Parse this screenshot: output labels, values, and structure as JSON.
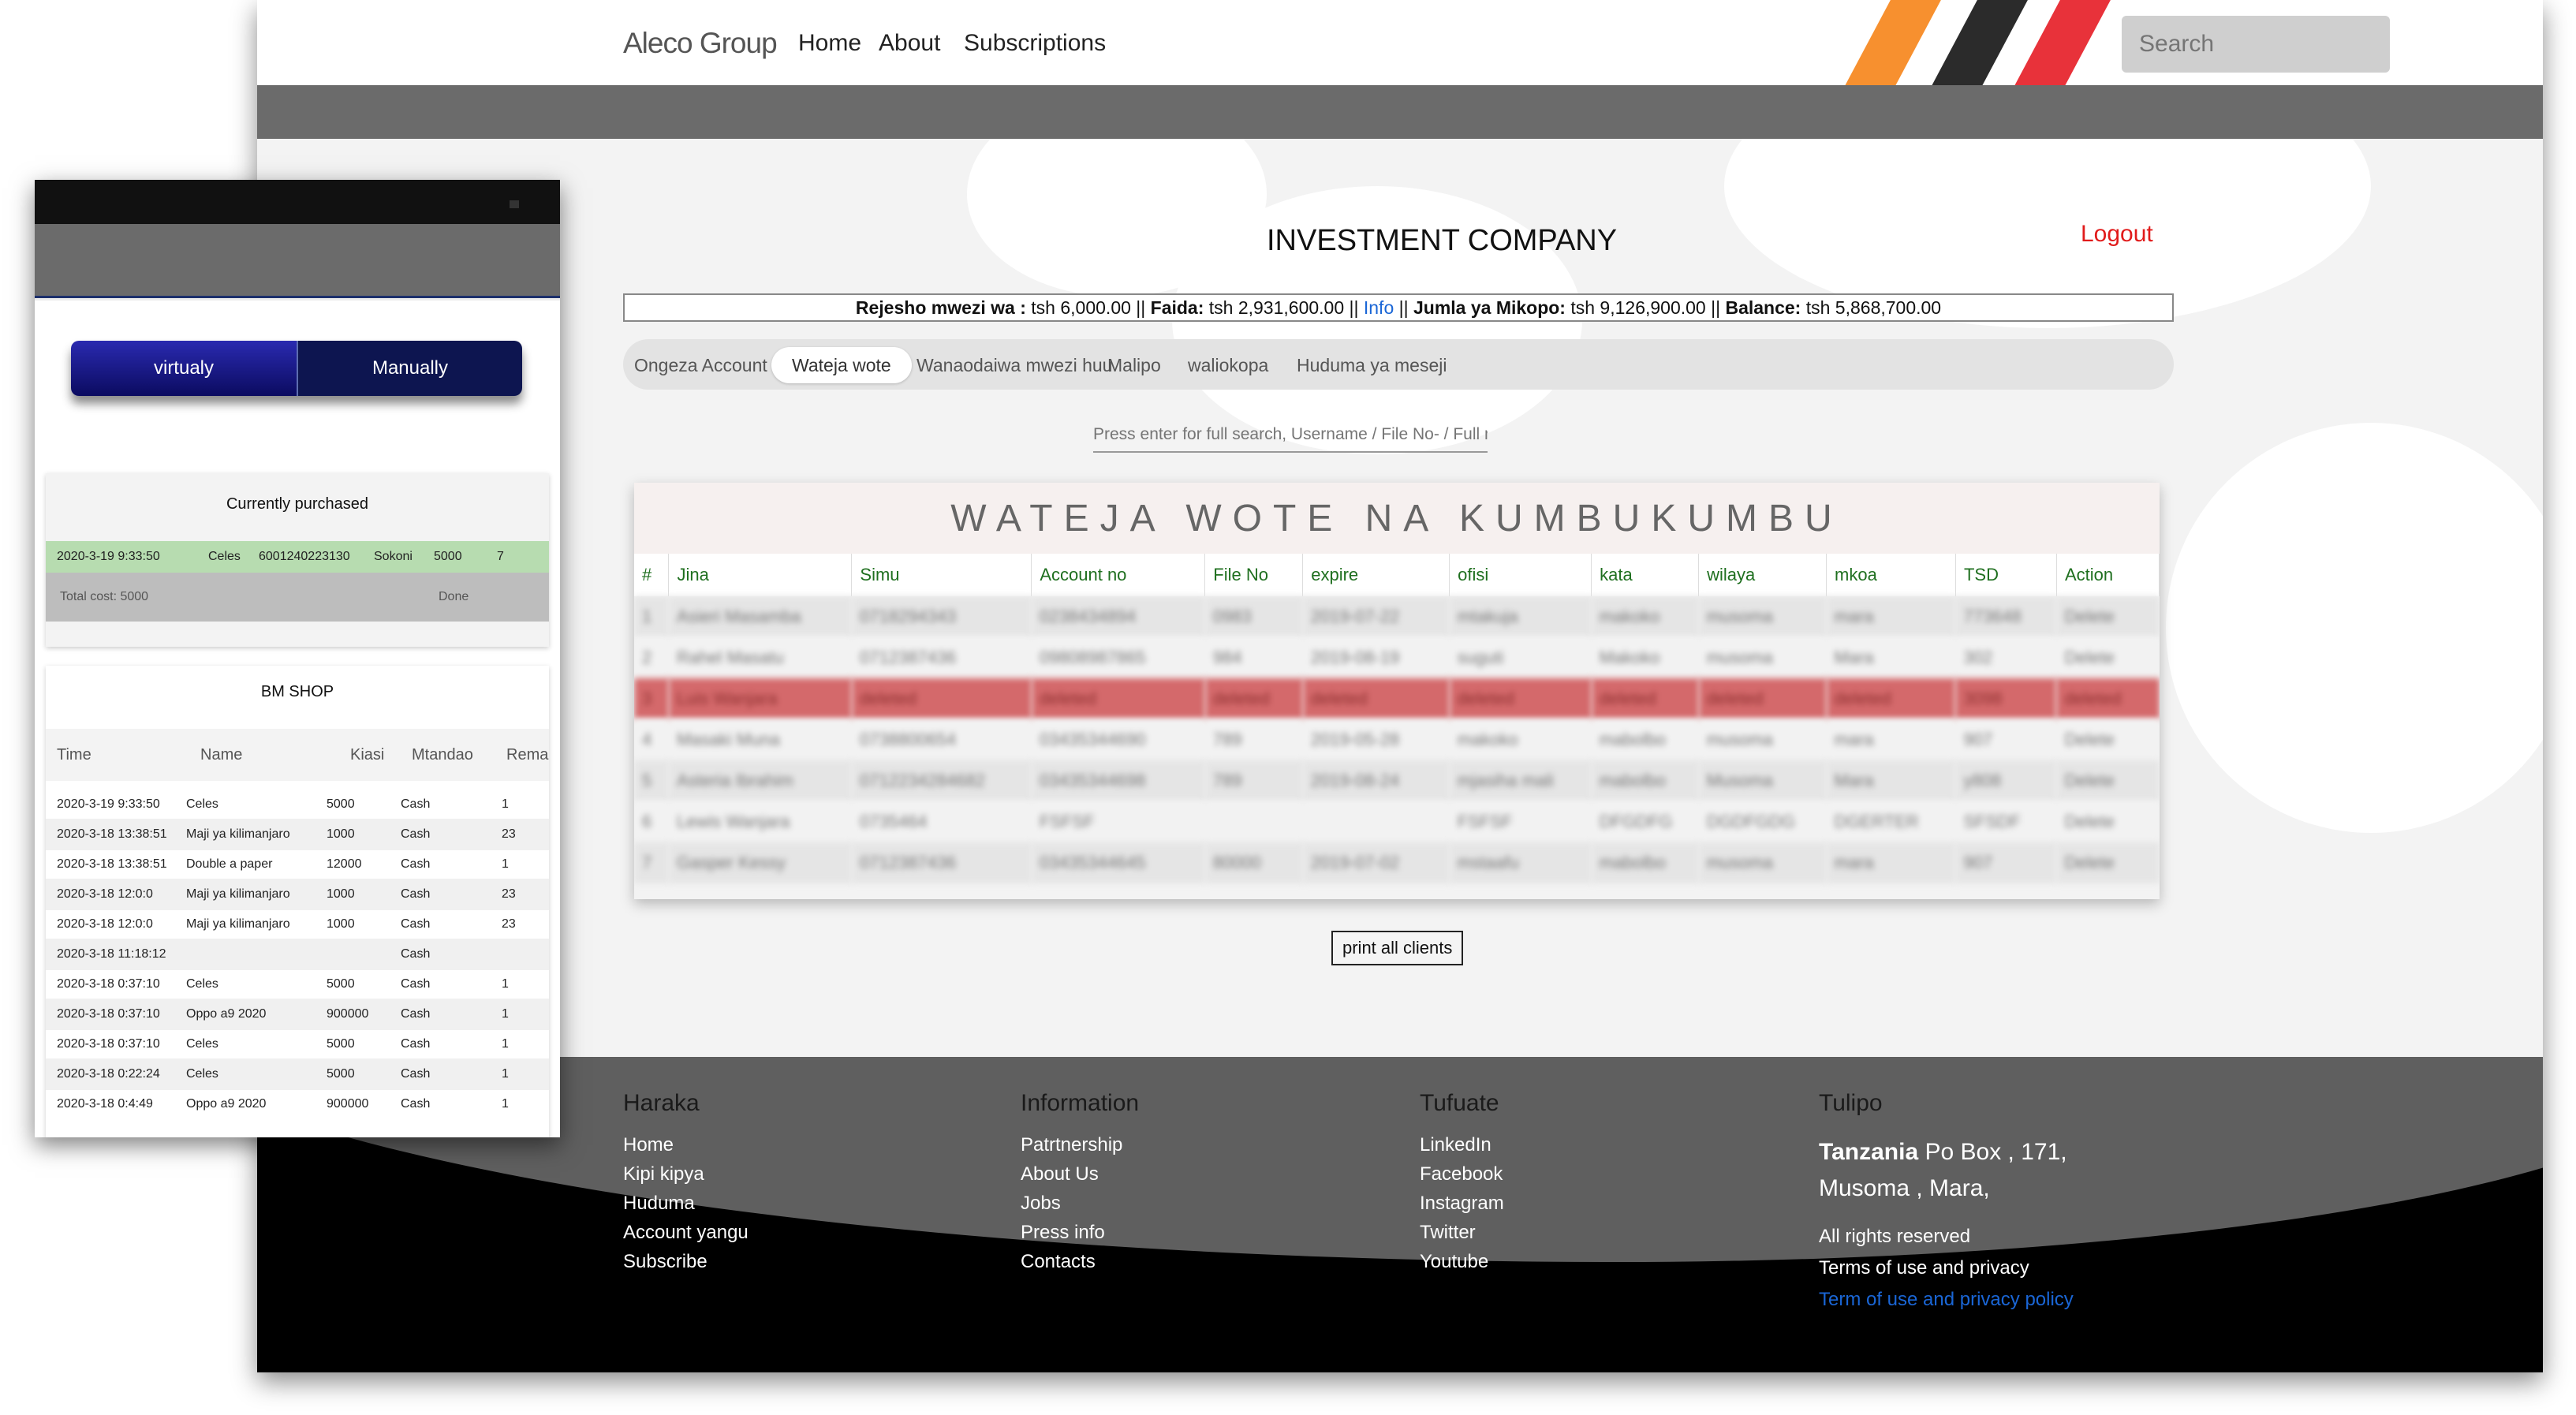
{
  "nav": {
    "brand": "Aleco Group",
    "links": [
      "Home",
      "About",
      "Subscriptions"
    ],
    "search_placeholder": "Search"
  },
  "company": {
    "name": "INVESTMENT COMPANY",
    "logout": "Logout"
  },
  "balance": {
    "rejesho_label": "Rejesho mwezi wa :",
    "rejesho_value": "tsh 6,000.00 ||",
    "faida_label": "Faida:",
    "faida_value": "tsh 2,931,600.00 ||",
    "info": "Info",
    "sep": "||",
    "jumla_label": "Jumla ya Mikopo:",
    "jumla_value": "tsh 9,126,900.00 ||",
    "balance_label": "Balance:",
    "balance_value": "tsh 5,868,700.00"
  },
  "tabs": [
    "Ongeza Account",
    "Wateja wote",
    "Wanaodaiwa mwezi huu",
    "Malipo",
    "waliokopa",
    "Huduma ya meseji"
  ],
  "search": {
    "placeholder": "Press enter for full search, Username / File No- / Full name / Region etc"
  },
  "clients_table": {
    "title": "WATEJA WOTE NA KUMBUKUMBU",
    "columns": [
      "#",
      "Jina",
      "Simu",
      "Account no",
      "File No",
      "expire",
      "ofisi",
      "kata",
      "wilaya",
      "mkoa",
      "TSD",
      "Action"
    ],
    "rows": [
      [
        "1",
        "Asieri Masamba",
        "0718294343",
        "0238434894",
        "0983",
        "2019-07-22",
        "mtakuja",
        "makoko",
        "musoma",
        "mara",
        "773648",
        "Delete"
      ],
      [
        "2",
        "Rahel Masatu",
        "0712387436",
        "09808987865",
        "984",
        "2019-08-19",
        "suguti",
        "Makoko",
        "musoma",
        "Mara",
        "302",
        "Delete"
      ],
      [
        "3",
        "Luis Wanjara",
        "deleted",
        "deleted",
        "deleted",
        "deleted",
        "deleted",
        "deleted",
        "deleted",
        "deleted",
        "3098",
        "deleted"
      ],
      [
        "4",
        "Masaki Muna",
        "0738800654",
        "03435344690",
        "789",
        "2019-05-28",
        "makoko",
        "mabolbo",
        "musoma",
        "mara",
        "907",
        "Delete"
      ],
      [
        "5",
        "Asteria Ibrahim",
        "0712234284682",
        "03435344698",
        "789",
        "2019-08-24",
        "mjasiha mali",
        "mabolbo",
        "Musoma",
        "Mara",
        "y808",
        "Delete"
      ],
      [
        "6",
        "Lewis Wanjara",
        "0735464",
        "FSFSF",
        "",
        "",
        "FSFSF",
        "DFGDFG",
        "DGDFGDG",
        "DGERTER",
        "SFSDF",
        "Delete"
      ],
      [
        "7",
        "Gasper Kessy",
        "0712387436",
        "03435344645",
        "80000",
        "2019-07-02",
        "mstaafu",
        "mabolbo",
        "musoma",
        "mara",
        "907",
        "Delete"
      ]
    ],
    "print_button": "print all clients"
  },
  "footer": {
    "haraka": {
      "title": "Haraka",
      "links": [
        "Home",
        "Kipi kipya",
        "Huduma",
        "Account yangu",
        "Subscribe"
      ]
    },
    "information": {
      "title": "Information",
      "links": [
        "Patrtnership",
        "About Us",
        "Jobs",
        "Press info",
        "Contacts"
      ]
    },
    "tufuate": {
      "title": "Tufuate",
      "links": [
        "LinkedIn",
        "Facebook",
        "Instagram",
        "Twitter",
        "Youtube"
      ]
    },
    "tulipo": {
      "title": "Tulipo",
      "country": "Tanzania",
      "address_rest": " Po Box , 171, Musoma , Mara,",
      "rights": "All rights reserved",
      "terms": "Terms of use and privacy",
      "terms_link": "Term of use and privacy policy"
    }
  },
  "mobile": {
    "toggle": {
      "virtual": "virtualy",
      "manual": "Manually"
    },
    "purchased": {
      "title": "Currently purchased",
      "row": [
        "2020-3-19 9:33:50",
        "Celes",
        "6001240223130",
        "Sokoni",
        "5000",
        "7"
      ],
      "total": "Total cost: 5000",
      "done": "Done"
    },
    "shop": {
      "title": "BM SHOP",
      "columns": [
        "Time",
        "Name",
        "Kiasi",
        "Mtandao",
        "Rema"
      ],
      "rows": [
        [
          "2020-3-19 9:33:50",
          "Celes",
          "5000",
          "Cash",
          "1"
        ],
        [
          "2020-3-18 13:38:51",
          "Maji ya kilimanjaro",
          "1000",
          "Cash",
          "23"
        ],
        [
          "2020-3-18 13:38:51",
          "Double a paper",
          "12000",
          "Cash",
          "1"
        ],
        [
          "2020-3-18 12:0:0",
          "Maji ya kilimanjaro",
          "1000",
          "Cash",
          "23"
        ],
        [
          "2020-3-18 12:0:0",
          "Maji ya kilimanjaro",
          "1000",
          "Cash",
          "23"
        ],
        [
          "2020-3-18 11:18:12",
          "",
          "",
          "Cash",
          ""
        ],
        [
          "2020-3-18 0:37:10",
          "Celes",
          "5000",
          "Cash",
          "1"
        ],
        [
          "2020-3-18 0:37:10",
          "Oppo a9 2020",
          "900000",
          "Cash",
          "1"
        ],
        [
          "2020-3-18 0:37:10",
          "Celes",
          "5000",
          "Cash",
          "1"
        ],
        [
          "2020-3-18 0:22:24",
          "Celes",
          "5000",
          "Cash",
          "1"
        ],
        [
          "2020-3-18 0:4:49",
          "Oppo a9 2020",
          "900000",
          "Cash",
          "1"
        ]
      ]
    }
  }
}
